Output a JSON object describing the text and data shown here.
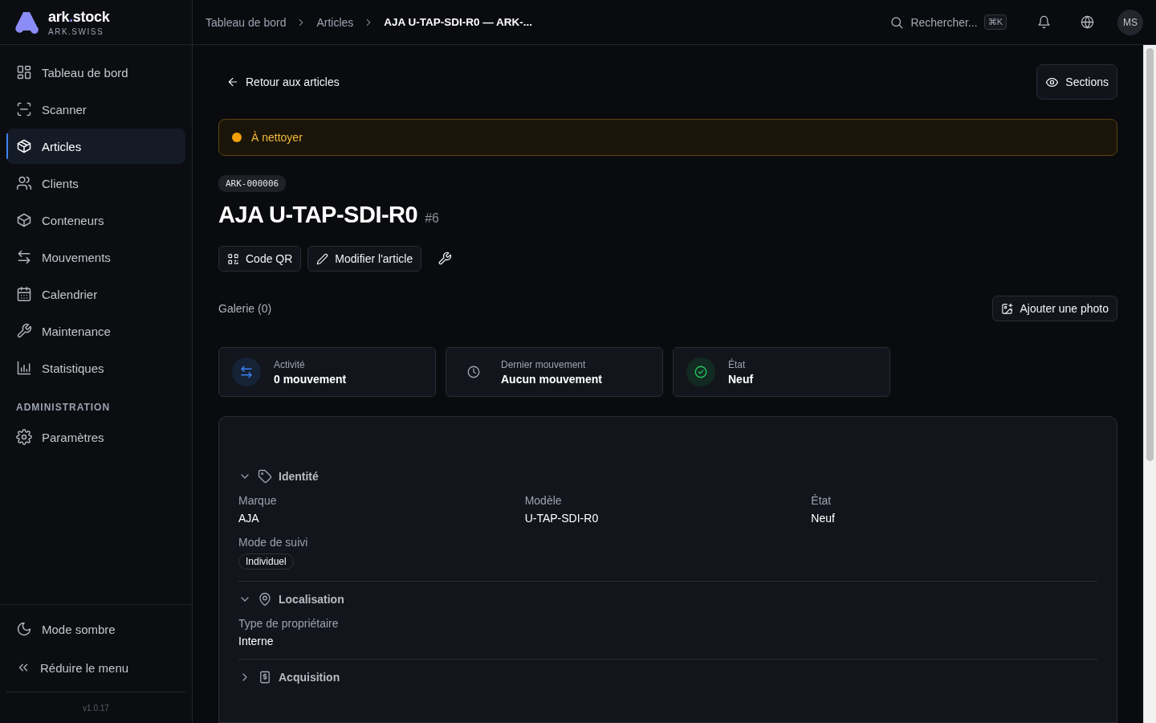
{
  "brand": {
    "name": "ark",
    "dot": ".",
    "name_end": "stock",
    "subtitle": "ARK.SWISS"
  },
  "sidebar": {
    "items": [
      {
        "label": "Tableau de bord",
        "selected": false
      },
      {
        "label": "Scanner",
        "selected": false
      },
      {
        "label": "Articles",
        "selected": true
      },
      {
        "label": "Clients",
        "selected": false
      },
      {
        "label": "Conteneurs",
        "selected": false
      },
      {
        "label": "Mouvements",
        "selected": false
      },
      {
        "label": "Calendrier",
        "selected": false
      },
      {
        "label": "Maintenance",
        "selected": false
      },
      {
        "label": "Statistiques",
        "selected": false
      }
    ],
    "section_title": "ADMINISTRATION",
    "admin_items": [
      {
        "label": "Paramètres",
        "selected": false
      }
    ],
    "footer_items": [
      "Mode sombre",
      "Réduire le menu"
    ],
    "version": "v1.0.17"
  },
  "breadcrumb": [
    "Tableau de bord",
    "Articles",
    "AJA U-TAP-SDI-R0 — ARK-..."
  ],
  "search": {
    "placeholder": "Rechercher...",
    "shortcut": "⌘K"
  },
  "avatar": "MS",
  "back_link": "Retour aux articles",
  "sections_button": "Sections",
  "status_banner": {
    "label": "À nettoyer",
    "color": "#f59e0b"
  },
  "item": {
    "code": "ARK-000006",
    "title": "AJA U-TAP-SDI-R0",
    "number": "#6"
  },
  "actions": [
    "Code QR",
    "Modifier l'article"
  ],
  "gallery": {
    "title": "Galerie (0)",
    "button": "Ajouter une photo"
  },
  "stats": [
    {
      "label": "Activité",
      "value": "0 mouvement",
      "color": "#3b82f6"
    },
    {
      "label": "Dernier mouvement",
      "value": "Aucun mouvement",
      "color": "#9ca3af"
    },
    {
      "label": "État",
      "value": "Neuf",
      "color": "#22c55e"
    }
  ],
  "sections": [
    {
      "title": "Identité",
      "expanded": true,
      "fields": [
        {
          "label": "Marque",
          "value": "AJA",
          "kind": "text"
        },
        {
          "label": "Modèle",
          "value": "U-TAP-SDI-R0",
          "kind": "text"
        },
        {
          "label": "État",
          "value": "Neuf",
          "kind": "text"
        },
        {
          "label": "Mode de suivi",
          "value": "Individuel",
          "kind": "tag"
        }
      ]
    },
    {
      "title": "Localisation",
      "expanded": true,
      "fields": [
        {
          "label": "Type de propriétaire",
          "value": "Interne",
          "kind": "text"
        }
      ]
    },
    {
      "title": "Acquisition",
      "expanded": false
    }
  ]
}
